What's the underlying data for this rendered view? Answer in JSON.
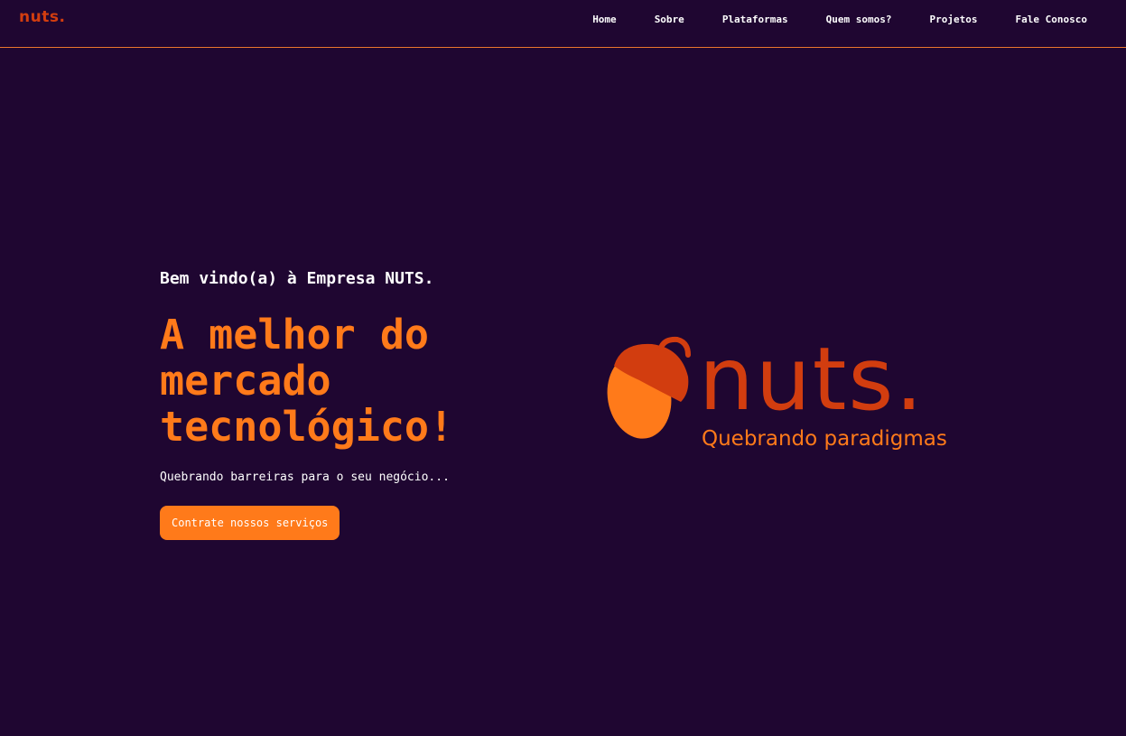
{
  "nav": {
    "logo_text": "nuts.",
    "links": [
      "Home",
      "Sobre",
      "Plataformas",
      "Quem somos?",
      "Projetos",
      "Fale Conosco"
    ]
  },
  "hero": {
    "welcome": "Bem vindo(a) à Empresa NUTS.",
    "headline": "A melhor do mercado tecnológico!",
    "subtext": "Quebrando barreiras para o seu negócio...",
    "cta_label": "Contrate nossos serviços"
  },
  "brand": {
    "wordmark": "nuts.",
    "tagline": "Quebrando paradigmas"
  },
  "colors": {
    "background": "#1f0631",
    "accent": "#ff7a1a",
    "logo_red": "#d23d0f",
    "border": "#e8762c",
    "text": "#ffffff"
  },
  "icons": {
    "logo": "acorn-icon"
  }
}
